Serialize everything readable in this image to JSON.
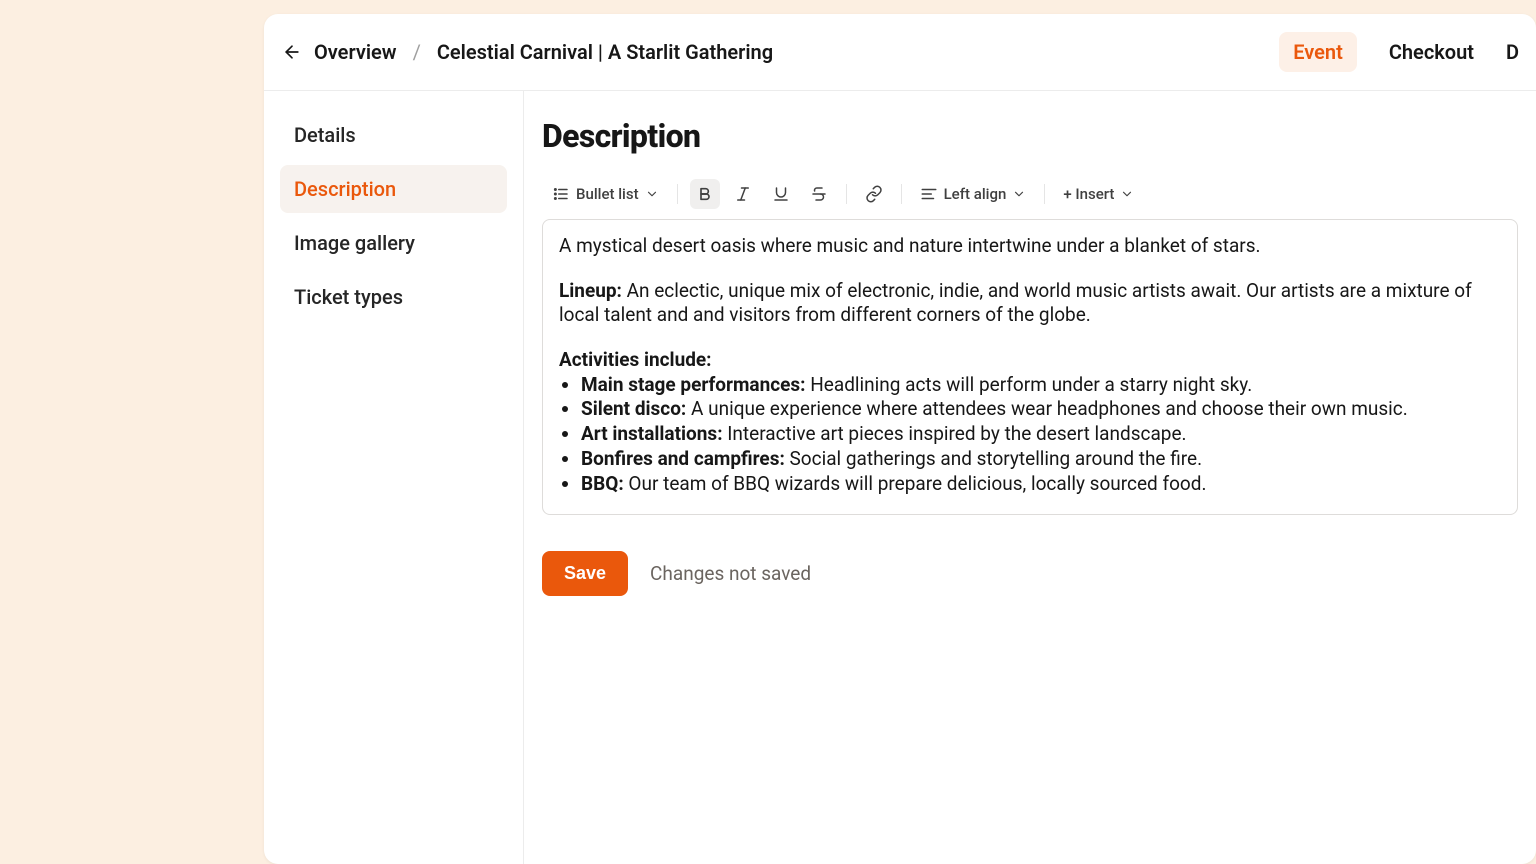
{
  "header": {
    "overview": "Overview",
    "title": "Celestial Carnival | A Starlit Gathering",
    "tabs": {
      "event": "Event",
      "checkout": "Checkout"
    }
  },
  "sidebar": {
    "details": "Details",
    "description": "Description",
    "image_gallery": "Image gallery",
    "ticket_types": "Ticket types"
  },
  "main": {
    "title": "Description",
    "toolbar": {
      "bullet_list": "Bullet list",
      "left_align": "Left align",
      "insert": "+ Insert"
    },
    "content": {
      "intro": "A mystical desert oasis where music and nature intertwine under a blanket of stars.",
      "lineup_label": "Lineup:",
      "lineup_text": " An eclectic, unique mix of electronic, indie, and world music artists await. Our artists are a mixture of local talent and and visitors from different corners of the globe.",
      "activities_label": "Activities include:",
      "items": [
        {
          "label": "Main stage performances:",
          "text": " Headlining acts will perform under a starry night sky."
        },
        {
          "label": "Silent disco:",
          "text": " A unique experience where attendees wear headphones and choose their own music."
        },
        {
          "label": "Art installations:",
          "text": " Interactive art pieces inspired by the desert landscape."
        },
        {
          "label": "Bonfires and campfires:",
          "text": " Social gatherings and storytelling around the fire."
        },
        {
          "label": "BBQ:",
          "text": " Our team of BBQ wizards will prepare delicious, locally sourced food."
        }
      ]
    },
    "save": {
      "button": "Save",
      "status": "Changes not saved"
    }
  }
}
